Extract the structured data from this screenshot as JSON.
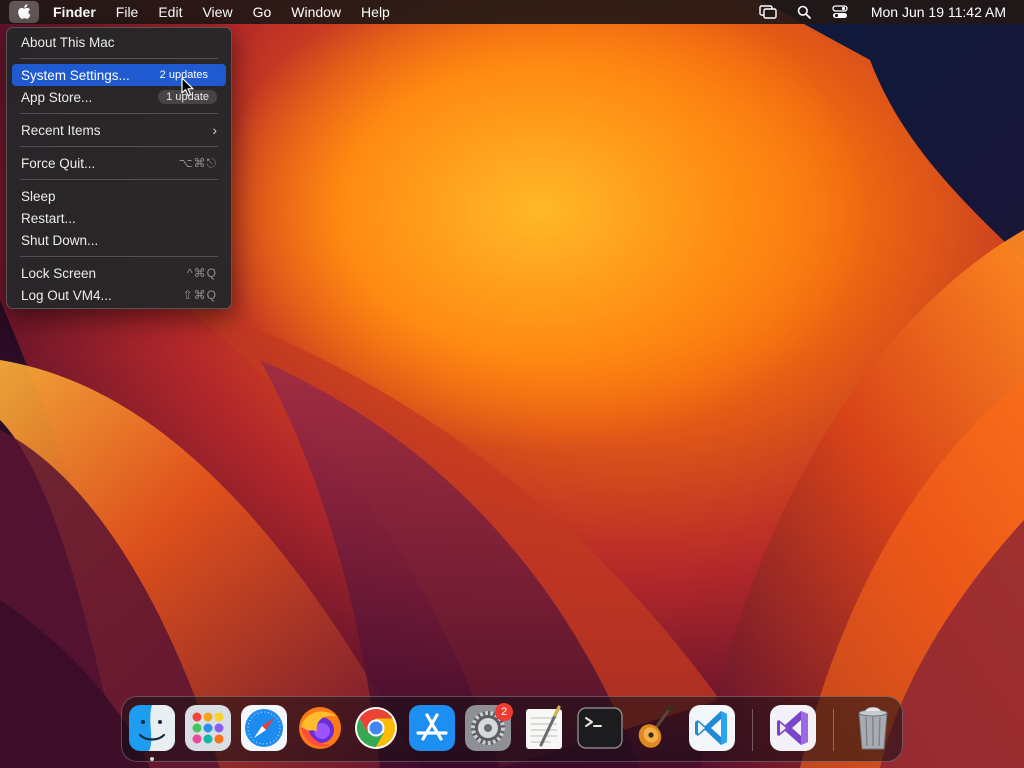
{
  "menubar": {
    "app_name": "Finder",
    "menus": [
      "File",
      "Edit",
      "View",
      "Go",
      "Window",
      "Help"
    ],
    "clock": "Mon Jun 19  11:42 AM",
    "status_icons": [
      "screen-mirroring-icon",
      "search-icon",
      "control-center-icon"
    ]
  },
  "apple_menu": {
    "about": "About This Mac",
    "system_settings": "System Settings...",
    "system_settings_badge": "2 updates",
    "app_store": "App Store...",
    "app_store_badge": "1 update",
    "recent_items": "Recent Items",
    "force_quit": "Force Quit...",
    "force_quit_shortcut": "⌥⌘⎋",
    "sleep": "Sleep",
    "restart": "Restart...",
    "shut_down": "Shut Down...",
    "lock_screen": "Lock Screen",
    "lock_screen_shortcut": "^⌘Q",
    "log_out": "Log Out VM4...",
    "log_out_shortcut": "⇧⌘Q"
  },
  "dock": {
    "apps": [
      "Finder",
      "Launchpad",
      "Safari",
      "Firefox",
      "Google Chrome",
      "App Store",
      "System Settings",
      "TextEdit",
      "Terminal",
      "GarageBand",
      "Visual Studio Code",
      "Visual Studio",
      "Trash"
    ],
    "system_settings_badge": "2"
  },
  "colors": {
    "highlight": "#1f5ad1",
    "badge": "#f03b30"
  }
}
